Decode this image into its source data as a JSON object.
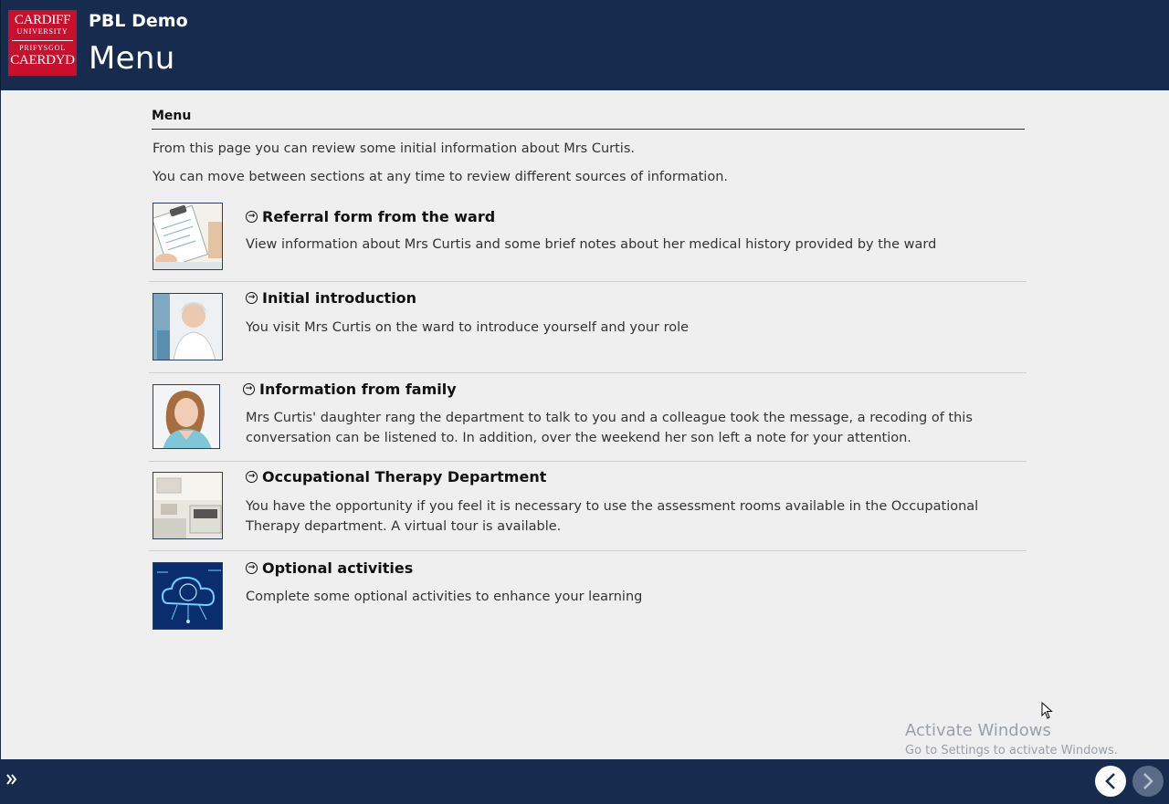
{
  "header": {
    "logo": {
      "line1": "CARDIFF",
      "line2": "UNIVERSITY",
      "line3": "PRIFYSGOL",
      "line4": "CAERDYD"
    },
    "app_title": "PBL Demo",
    "page_title": "Menu"
  },
  "main": {
    "section_heading": "Menu",
    "intro": [
      "From this page you can review some initial information about Mrs Curtis.",
      "You can move between sections at any time to review different sources of information."
    ],
    "items": [
      {
        "title": "Referral form from the ward",
        "description": "View information about Mrs Curtis and some brief notes about her medical history provided by the ward",
        "thumbnail_icon": "clipboard-image"
      },
      {
        "title": "Initial introduction",
        "description": "You visit Mrs Curtis on the ward to introduce yourself and your role",
        "thumbnail_icon": "elderly-patient-image"
      },
      {
        "title": "Information from family",
        "description": "Mrs Curtis' daughter rang the department to talk to you and a colleague took the message, a recoding of this conversation can be listened to. In addition, over the weekend her son left a note for your attention.",
        "thumbnail_icon": "nurse-image"
      },
      {
        "title": "Occupational Therapy Department",
        "description": "You have the opportunity if you feel it is necessary to use the assessment rooms available in the Occupational Therapy department. A virtual tour is available.",
        "thumbnail_icon": "kitchen-image"
      },
      {
        "title": "Optional activities",
        "description": "Complete some optional activities to enhance your learning",
        "thumbnail_icon": "cloud-brain-image"
      }
    ]
  },
  "watermark": {
    "line1": "Activate Windows",
    "line2": "Go to Settings to activate Windows."
  },
  "footer": {
    "expand_icon": "double-chevron-right-icon",
    "prev_icon": "chevron-left-icon",
    "next_icon": "chevron-right-icon"
  },
  "colors": {
    "header_bg": "#162b4d",
    "logo_red": "#c8102e",
    "page_bg": "#efefef"
  }
}
